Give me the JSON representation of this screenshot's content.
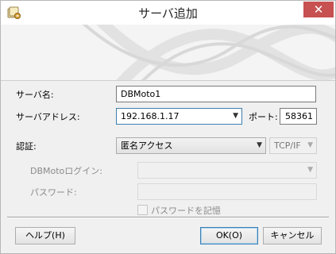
{
  "window": {
    "title": "サーバ追加",
    "close_symbol": "✕"
  },
  "form": {
    "server_name_label": "サーバ名:",
    "server_name_value": "DBMoto1",
    "server_address_label": "サーバアドレス:",
    "server_address_value": "192.168.1.17",
    "port_label": "ポート:",
    "port_value": "58361",
    "auth_label": "認証:",
    "auth_value": "匿名アクセス",
    "protocol_value": "TCP/IF",
    "login_label": "DBMotoログイン:",
    "login_value": "",
    "password_label": "パスワード:",
    "password_value": "",
    "remember_password_label": "パスワードを記憶",
    "remember_password_checked": false
  },
  "buttons": {
    "help": "ヘルプ(H)",
    "ok": "OK(O)",
    "cancel": "キャンセル"
  },
  "icons": {
    "app": "server-add-icon",
    "close": "close-icon",
    "dropdown": "chevron-down-icon"
  },
  "colors": {
    "close_button": "#c75050",
    "focus_border": "#3c7fb1"
  }
}
